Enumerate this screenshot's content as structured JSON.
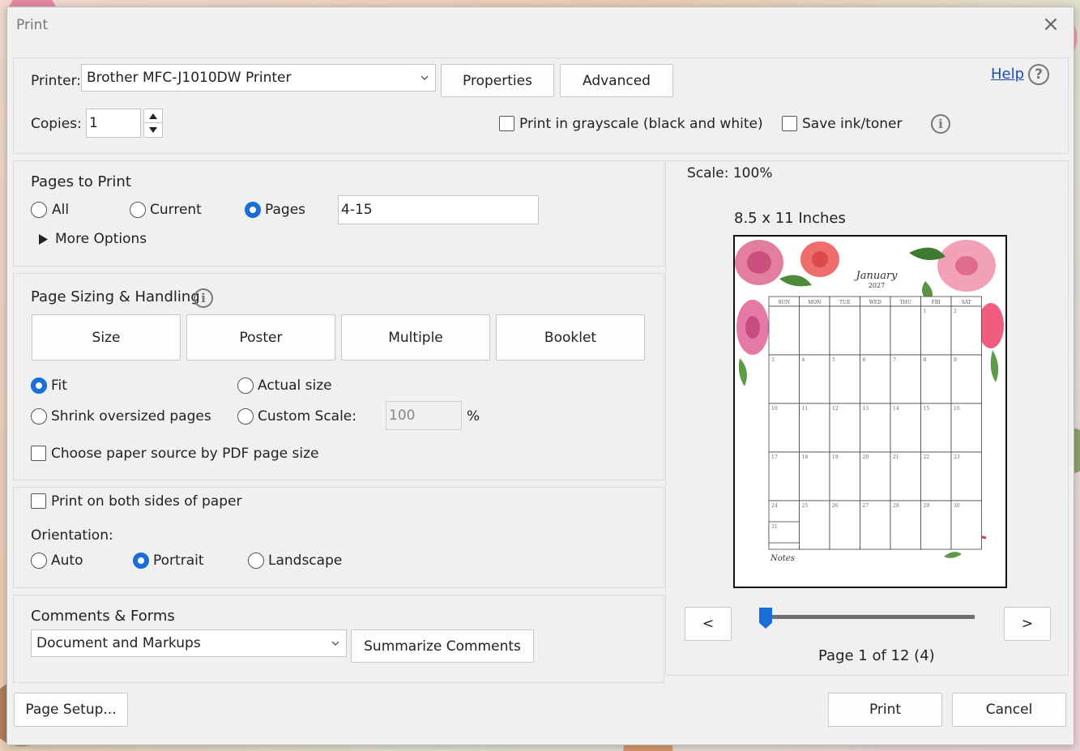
{
  "window": {
    "title": "Print"
  },
  "printer": {
    "label": "Printer:",
    "selected": "Brother MFC-J1010DW Printer",
    "properties_label": "Properties",
    "advanced_label": "Advanced",
    "help_label": "Help",
    "copies_label": "Copies:",
    "copies_value": "1",
    "grayscale_label": "Print in grayscale (black and white)",
    "save_ink_label": "Save ink/toner"
  },
  "pages_to_print": {
    "heading": "Pages to Print",
    "all_label": "All",
    "current_label": "Current",
    "pages_label": "Pages",
    "pages_value": "4-15",
    "more_options_label": "More Options"
  },
  "sizing": {
    "heading": "Page Sizing & Handling",
    "tabs": [
      "Size",
      "Poster",
      "Multiple",
      "Booklet"
    ],
    "fit_label": "Fit",
    "actual_label": "Actual size",
    "shrink_label": "Shrink oversized pages",
    "custom_label": "Custom Scale:",
    "custom_value": "100",
    "percent": "%",
    "paper_source_label": "Choose paper source by PDF page size"
  },
  "duplex": {
    "both_sides_label": "Print on both sides of paper",
    "orientation_label": "Orientation:",
    "auto_label": "Auto",
    "portrait_label": "Portrait",
    "landscape_label": "Landscape"
  },
  "comments": {
    "heading": "Comments & Forms",
    "selected": "Document and Markups",
    "summarize_label": "Summarize Comments"
  },
  "preview": {
    "scale_text": "Scale: 100%",
    "paper_size": "8.5 x 11 Inches",
    "prev_label": "<",
    "next_label": ">",
    "page_indicator": "Page 1 of 12 (4)",
    "slider_position": 0,
    "calendar": {
      "month": "January",
      "year": "2027",
      "days": [
        "SUN",
        "MON",
        "TUE",
        "WED",
        "THU",
        "FRI",
        "SAT"
      ],
      "weeks": [
        [
          "",
          "",
          "",
          "",
          "",
          "1",
          "2"
        ],
        [
          "3",
          "4",
          "5",
          "6",
          "7",
          "8",
          "9"
        ],
        [
          "10",
          "11",
          "12",
          "13",
          "14",
          "15",
          "16"
        ],
        [
          "17",
          "18",
          "19",
          "20",
          "21",
          "22",
          "23"
        ],
        [
          "24",
          "25",
          "26",
          "27",
          "28",
          "29",
          "30"
        ],
        [
          "31",
          "",
          "",
          "",
          "",
          "",
          ""
        ]
      ],
      "notes_label": "Notes"
    }
  },
  "footer": {
    "page_setup_label": "Page Setup...",
    "print_label": "Print",
    "cancel_label": "Cancel"
  }
}
